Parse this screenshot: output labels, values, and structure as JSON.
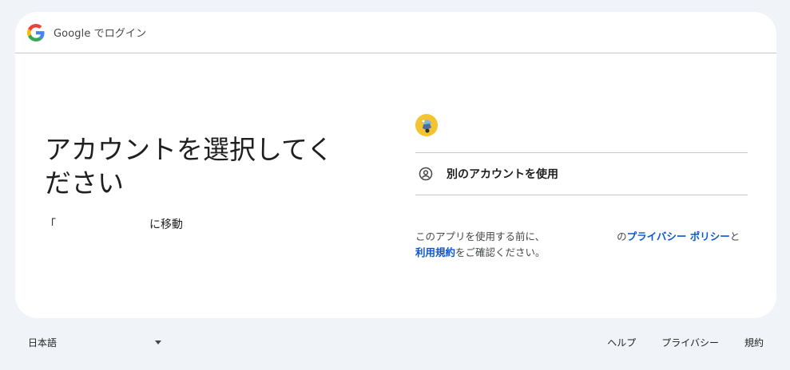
{
  "header": {
    "title": "Google でログイン",
    "logo_icon": "google-g-icon"
  },
  "left": {
    "heading_line1": "アカウントを選択してく",
    "heading_line2": "ださい",
    "continue_open_quote": "「",
    "continue_to": "に移動"
  },
  "right": {
    "account_avatar_icon": "user-avatar-icon",
    "other_account_icon": "account-circle-icon",
    "other_account_label": "別のアカウントを使用",
    "disclaimer_prefix": "このアプリを使用する前に、",
    "disclaimer_of": "の",
    "privacy_policy": "プライバシー ポリシー",
    "disclaimer_and": "と",
    "terms": "利用規約",
    "disclaimer_suffix": "をご確認ください。"
  },
  "footer": {
    "language": "日本語",
    "help": "ヘルプ",
    "privacy": "プライバシー",
    "terms": "規約"
  },
  "colors": {
    "background": "#f0f4f9",
    "card": "#ffffff",
    "link": "#0b57d0",
    "divider": "#c4c7c5"
  }
}
